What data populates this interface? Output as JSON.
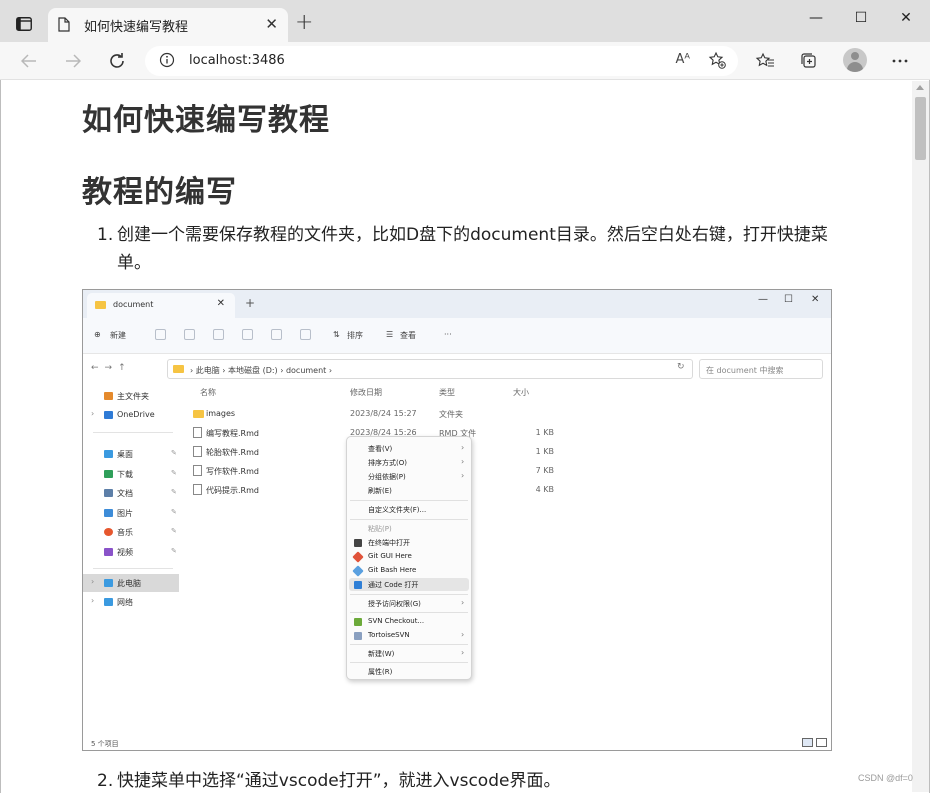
{
  "browser": {
    "tab_title": "如何快速编写教程",
    "url": "localhost:3486",
    "read_aloud_label": "Aᴬ"
  },
  "page": {
    "h1": "如何快速编写教程",
    "h2": "教程的编写",
    "steps": [
      {
        "num": "1.",
        "text": "创建一个需要保存教程的文件夹，比如D盘下的document目录。然后空白处右键，打开快捷菜单。"
      },
      {
        "num": "2.",
        "text": "快捷菜单中选择“通过vscode打开”，就进入vscode界面。"
      }
    ]
  },
  "explorer": {
    "tab_label": "document",
    "new_btn": "新建",
    "sort_btn": "排序",
    "view_btn": "查看",
    "more": "···",
    "breadcrumb": "›  此电脑  ›  本地磁盘 (D:)  ›  document  ›",
    "search_placeholder": "在 document 中搜索",
    "columns": {
      "name": "名称",
      "date": "修改日期",
      "type": "类型",
      "size": "大小"
    },
    "files": [
      {
        "name": "images",
        "date": "2023/8/24 15:27",
        "type": "文件夹",
        "size": "",
        "folder": true
      },
      {
        "name": "编写教程.Rmd",
        "date": "2023/8/24 15:26",
        "type": "RMD 文件",
        "size": "1 KB",
        "folder": false
      },
      {
        "name": "轮胎软件.Rmd",
        "date": "",
        "type": "",
        "size": "1 KB",
        "folder": false
      },
      {
        "name": "写作软件.Rmd",
        "date": "",
        "type": "",
        "size": "7 KB",
        "folder": false
      },
      {
        "name": "代码提示.Rmd",
        "date": "",
        "type": "",
        "size": "4 KB",
        "folder": false
      }
    ],
    "sidebar": [
      {
        "label": "主文件夹",
        "color": "#e58a2c"
      },
      {
        "label": "OneDrive",
        "color": "#2f7bd6"
      },
      {
        "label": "桌面",
        "color": "#3b9ae0"
      },
      {
        "label": "下载",
        "color": "#2f9f5a"
      },
      {
        "label": "文档",
        "color": "#5d7fa8"
      },
      {
        "label": "图片",
        "color": "#3d8cd8"
      },
      {
        "label": "音乐",
        "color": "#e6572e"
      },
      {
        "label": "视频",
        "color": "#8a53c9"
      },
      {
        "label": "此电脑",
        "color": "#3b9ae0"
      },
      {
        "label": "网络",
        "color": "#3b9ae0"
      }
    ],
    "status": "5 个项目",
    "context_menu": [
      {
        "label": "查看(V)",
        "arrow": true
      },
      {
        "label": "排序方式(O)",
        "arrow": true
      },
      {
        "label": "分组依据(P)",
        "arrow": true
      },
      {
        "label": "刷新(E)",
        "arrow": false
      },
      {
        "label": "自定义文件夹(F)...",
        "arrow": false
      },
      {
        "label": "粘贴(P)",
        "arrow": false,
        "dim": true
      },
      {
        "label": "在终端中打开",
        "arrow": false,
        "icon": "#444444"
      },
      {
        "label": "Git GUI Here",
        "arrow": false,
        "icon": "#e0533a"
      },
      {
        "label": "Git Bash Here",
        "arrow": false,
        "icon": "#5aa0e0"
      },
      {
        "label": "通过 Code 打开",
        "arrow": false,
        "icon": "#2f7fd6",
        "highlight": true
      },
      {
        "label": "授予访问权限(G)",
        "arrow": true
      },
      {
        "label": "SVN Checkout...",
        "arrow": false,
        "icon": "#6caa3a"
      },
      {
        "label": "TortoiseSVN",
        "arrow": true,
        "icon": "#8aa0c0"
      },
      {
        "label": "新建(W)",
        "arrow": true
      },
      {
        "label": "属性(R)",
        "arrow": false
      }
    ]
  },
  "watermark": "CSDN @df=0"
}
